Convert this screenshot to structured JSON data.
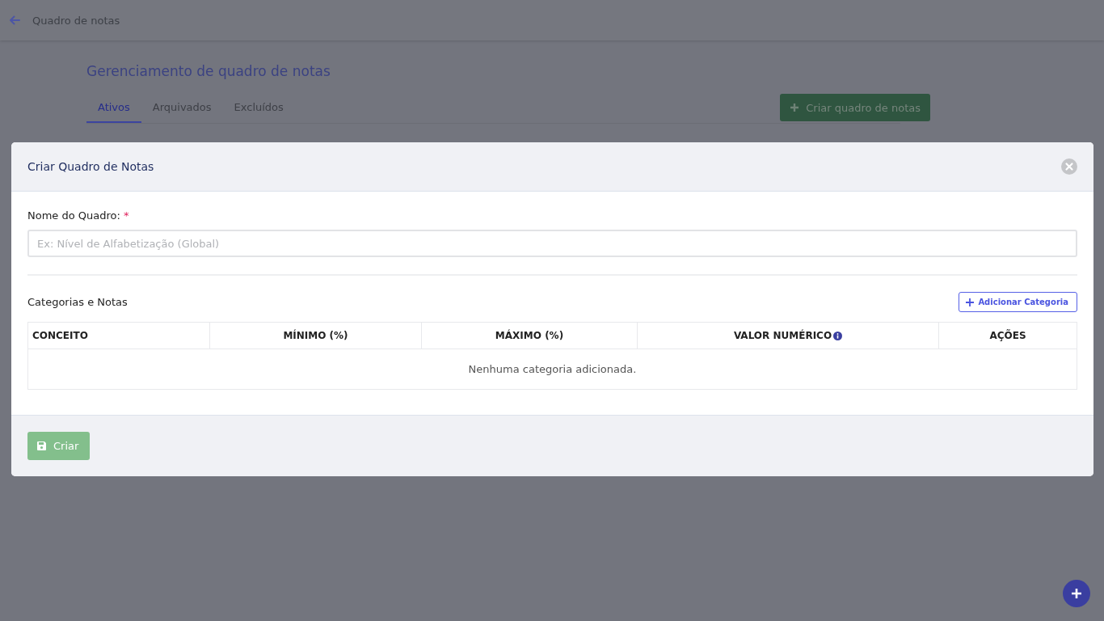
{
  "header": {
    "title": "Quadro de notas"
  },
  "page": {
    "title": "Gerenciamento de quadro de notas",
    "tabs": [
      {
        "label": "Ativos",
        "selected": true
      },
      {
        "label": "Arquivados",
        "selected": false
      },
      {
        "label": "Excluídos",
        "selected": false
      }
    ],
    "create_button": "Criar quadro de notas"
  },
  "modal": {
    "title": "Criar Quadro de Notas",
    "name_field": {
      "label": "Nome do Quadro:",
      "required": true,
      "required_mark": "*",
      "placeholder": "Ex: Nível de Alfabetização (Global)"
    },
    "categories": {
      "title": "Categorias e Notas",
      "add_button": "Adicionar Categoria",
      "columns": [
        {
          "label": "CONCEITO",
          "info": false
        },
        {
          "label": "MÍNIMO (%)",
          "info": false
        },
        {
          "label": "MÁXIMO (%)",
          "info": false
        },
        {
          "label": "VALOR NUMÉRICO",
          "info": true
        },
        {
          "label": "AÇÕES",
          "info": false
        }
      ],
      "empty": "Nenhuma categoria adicionada."
    },
    "submit": {
      "label": "Criar",
      "disabled": true
    }
  }
}
